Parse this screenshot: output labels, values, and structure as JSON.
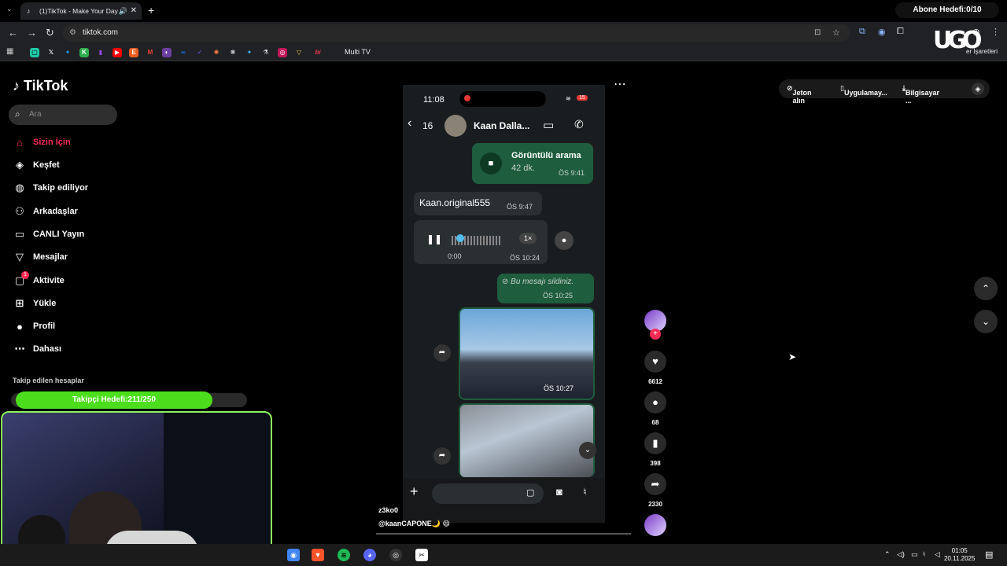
{
  "browser": {
    "tab_title": "(1)TikTok - Make Your Day",
    "url": "tiktok.com",
    "bookmark_multitv": "Multi TV",
    "bookmarks_right": "er İşaretleri",
    "overlay_logo": "UGO",
    "abone": "Abone Hedefi:0/10"
  },
  "sidebar": {
    "logo": "TikTok",
    "search_placeholder": "Ara",
    "items": [
      {
        "label": "Sizin İçin"
      },
      {
        "label": "Keşfet"
      },
      {
        "label": "Takip ediliyor"
      },
      {
        "label": "Arkadaşlar"
      },
      {
        "label": "CANLI Yayın"
      },
      {
        "label": "Mesajlar"
      },
      {
        "label": "Aktivite"
      },
      {
        "label": "Yükle"
      },
      {
        "label": "Profil"
      },
      {
        "label": "Dahası"
      }
    ],
    "activity_badge": "1",
    "followed_title": "Takip edilen hesaplar"
  },
  "topright": {
    "coins": "Jeton alın",
    "app": "Uygulamay...",
    "pc": "Bilgisayar ..."
  },
  "video": {
    "status_time": "11:08",
    "battery": "15",
    "back_count": "16",
    "contact_name": "Kaan Dalla...",
    "call_title": "Görüntülü arama",
    "call_duration": "42 dk.",
    "call_time": "ÖS 9:41",
    "msg1_text": "Kaan.original555",
    "msg1_time": "ÖS 9:47",
    "voice_elapsed": "0:00",
    "voice_speed": "1×",
    "voice_time": "ÖS 10:24",
    "deleted_text": "Bu mesajı sildiniz.",
    "deleted_time": "ÖS 10:25",
    "photo_time": "ÖS 10:27"
  },
  "rail": {
    "likes": "6612",
    "comments": "68",
    "saves": "398",
    "shares": "2330"
  },
  "caption": {
    "user": "z3ko0",
    "tag": "@kaanCAPONE🌙 😄"
  },
  "overlay": {
    "takipci": "Takipçi Hedefi:211/250"
  },
  "taskbar": {
    "time": "01:05",
    "date": "20.11.2025"
  }
}
